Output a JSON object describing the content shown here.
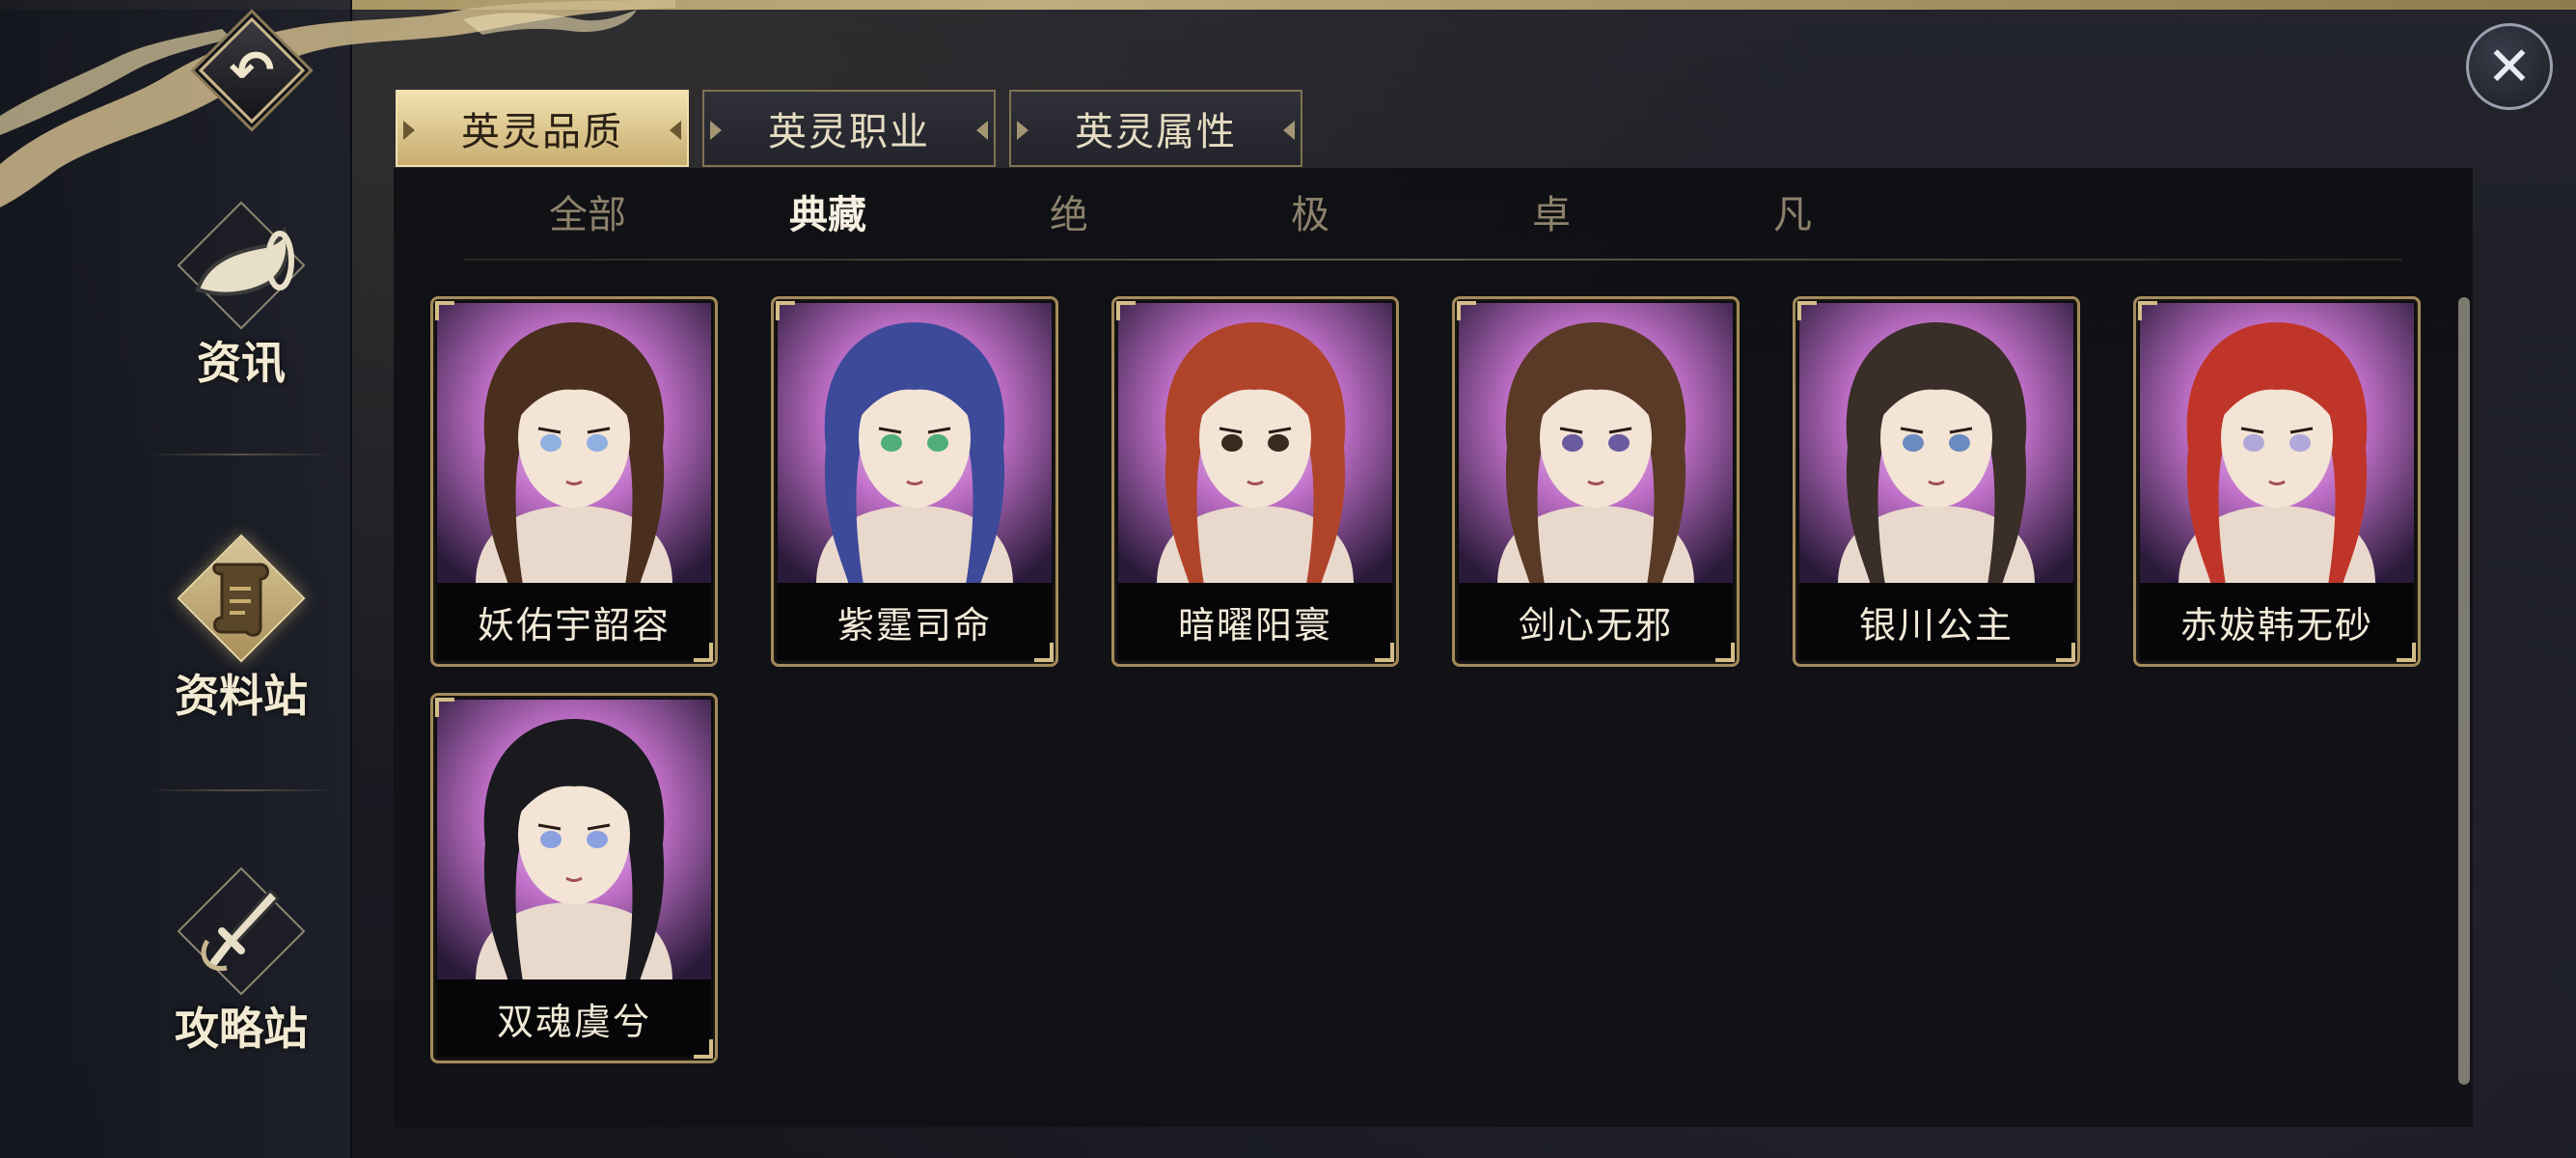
{
  "sidebar": {
    "back_icon": "back-arrow-icon",
    "items": [
      {
        "label": "资讯",
        "icon": "horn-icon",
        "active": false
      },
      {
        "label": "资料站",
        "icon": "scroll-icon",
        "active": true
      },
      {
        "label": "攻略站",
        "icon": "sword-icon",
        "active": false
      }
    ]
  },
  "close_icon": "close-icon",
  "tabs": [
    {
      "label": "英灵品质",
      "active": true
    },
    {
      "label": "英灵职业",
      "active": false
    },
    {
      "label": "英灵属性",
      "active": false
    }
  ],
  "subtabs": [
    {
      "label": "全部",
      "active": false
    },
    {
      "label": "典藏",
      "active": true
    },
    {
      "label": "绝",
      "active": false
    },
    {
      "label": "极",
      "active": false
    },
    {
      "label": "卓",
      "active": false
    },
    {
      "label": "凡",
      "active": false
    }
  ],
  "heroes": [
    {
      "name": "妖佑宇韶容",
      "hair": "#4a2e1e",
      "eyes": "#8fb0e0"
    },
    {
      "name": "紫霆司命",
      "hair": "#3d4a9a",
      "eyes": "#4fae7a"
    },
    {
      "name": "暗曜阳寰",
      "hair": "#b0442a",
      "eyes": "#3a2a20"
    },
    {
      "name": "剑心无邪",
      "hair": "#5a3a26",
      "eyes": "#6a5aa0"
    },
    {
      "name": "银川公主",
      "hair": "#3a2e28",
      "eyes": "#6a8ac0"
    },
    {
      "name": "赤妭韩无砂",
      "hair": "#c0352a",
      "eyes": "#b0a8d8"
    },
    {
      "name": "双魂虞兮",
      "hair": "#1a1a1e",
      "eyes": "#8aa0e0"
    }
  ],
  "colors": {
    "accent_gold": "#c8ad70",
    "panel_bg": "#121216",
    "card_border": "#a48b5c"
  }
}
